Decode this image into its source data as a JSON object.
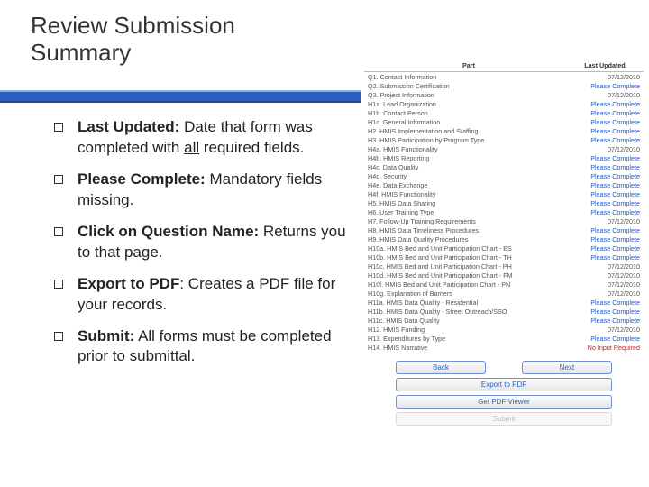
{
  "title_line1": "Review Submission",
  "title_line2": "Summary",
  "bullets": [
    {
      "bold": "Last Updated:",
      "rest_pre": "  Date that form was completed with ",
      "under": "all",
      "rest_post": " required fields."
    },
    {
      "bold": "Please Complete:",
      "rest": "  Mandatory fields missing."
    },
    {
      "bold": "Click on Question Name:",
      "rest": "  Returns you to that page."
    },
    {
      "bold": "Export to PDF",
      "rest": ":  Creates a PDF file for your records."
    },
    {
      "bold": "Submit:",
      "rest": "  All forms must be completed prior to submittal."
    }
  ],
  "panel": {
    "header_part": "Part",
    "header_updated": "Last Updated",
    "rows": [
      {
        "name": "Q1. Contact Information",
        "status": "07/12/2010"
      },
      {
        "name": "Q2. Submission Certification",
        "status": "Please Complete",
        "pc": true
      },
      {
        "name": "Q3. Project Information",
        "status": "07/12/2010"
      },
      {
        "name": "H1a. Lead Organization",
        "status": "Please Complete",
        "pc": true
      },
      {
        "name": "H1b. Contact Person",
        "status": "Please Complete",
        "pc": true
      },
      {
        "name": "H1c. General Information",
        "status": "Please Complete",
        "pc": true
      },
      {
        "name": "H2. HMIS Implementation and Staffing",
        "status": "Please Complete",
        "pc": true
      },
      {
        "name": "H3. HMIS Participation by Program Type",
        "status": "Please Complete",
        "pc": true
      },
      {
        "name": "H4a. HMIS Functionality",
        "status": "07/12/2010"
      },
      {
        "name": "H4b. HMIS Reporting",
        "status": "Please Complete",
        "pc": true
      },
      {
        "name": "H4c. Data Quality",
        "status": "Please Complete",
        "pc": true
      },
      {
        "name": "H4d. Security",
        "status": "Please Complete",
        "pc": true
      },
      {
        "name": "H4e. Data Exchange",
        "status": "Please Complete",
        "pc": true
      },
      {
        "name": "H4f. HMIS Functionality",
        "status": "Please Complete",
        "pc": true
      },
      {
        "name": "H5. HMIS Data Sharing",
        "status": "Please Complete",
        "pc": true
      },
      {
        "name": "H6. User Training Type",
        "status": "Please Complete",
        "pc": true
      },
      {
        "name": "H7. Follow-Up Training Requirements",
        "status": "07/12/2010"
      },
      {
        "name": "H8. HMIS Data Timeliness Procedures",
        "status": "Please Complete",
        "pc": true
      },
      {
        "name": "H9. HMIS Data Quality Procedures",
        "status": "Please Complete",
        "pc": true
      },
      {
        "name": "H10a. HMIS Bed and Unit Participation Chart - ES",
        "status": "Please Complete",
        "pc": true
      },
      {
        "name": "H10b. HMIS Bed and Unit Participation Chart - TH",
        "status": "Please Complete",
        "pc": true
      },
      {
        "name": "H10c. HMIS Bed and Unit Participation Chart - PH",
        "status": "07/12/2010"
      },
      {
        "name": "H10d. HMIS Bed and Unit Participation Chart - FM",
        "status": "07/12/2010"
      },
      {
        "name": "H10f. HMIS Bed and Unit Participation Chart - PN",
        "status": "07/12/2010"
      },
      {
        "name": "H10g. Explanation of Barriers",
        "status": "07/12/2010"
      },
      {
        "name": "H11a. HMIS Data Quality - Residential",
        "status": "Please Complete",
        "pc": true
      },
      {
        "name": "H11b. HMIS Data Quality - Street Outreach/SSO",
        "status": "Please Complete",
        "pc": true
      },
      {
        "name": "H11c. HMIS Data Quality",
        "status": "Please Complete",
        "pc": true
      },
      {
        "name": "H12. HMIS Funding",
        "status": "07/12/2010"
      },
      {
        "name": "H13. Expenditures by Type",
        "status": "Please Complete",
        "pc": true
      },
      {
        "name": "H14. HMIS Narrative",
        "status": "No Input Required",
        "red": true
      }
    ],
    "buttons": {
      "back": "Back",
      "next": "Next",
      "export": "Export to PDF",
      "viewer": "Get PDF Viewer",
      "submit": "Submit"
    }
  }
}
